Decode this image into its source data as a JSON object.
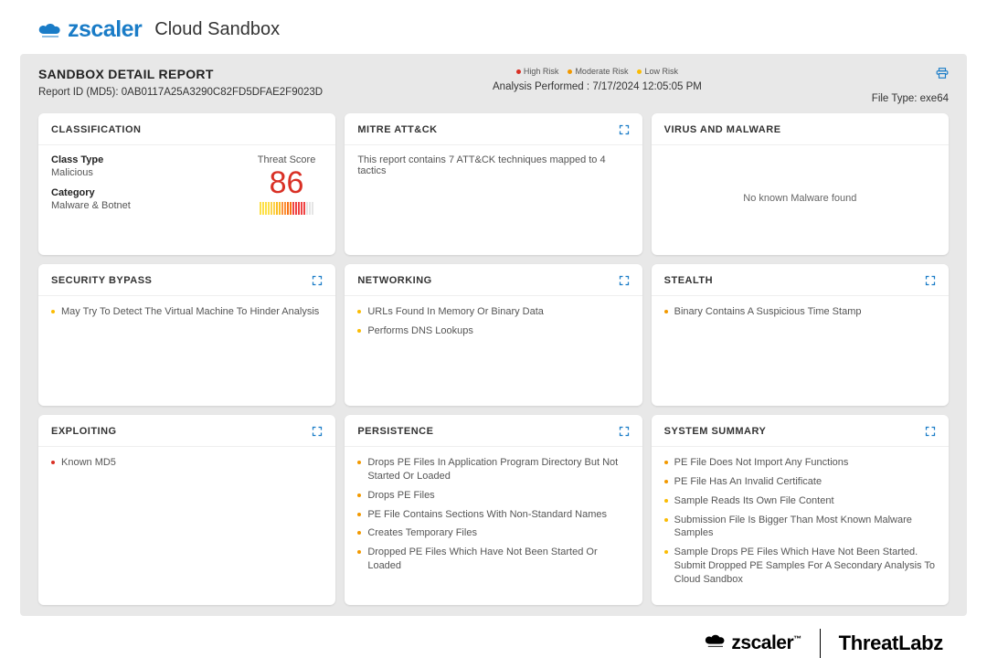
{
  "header": {
    "brand": "zscaler",
    "product": "Cloud Sandbox"
  },
  "report": {
    "title": "SANDBOX DETAIL REPORT",
    "id_label": "Report ID (MD5):",
    "id_value": "0AB0117A25A3290C82FD5DFAE2F9023D",
    "analysis_label": "Analysis Performed :",
    "analysis_time": "7/17/2024 12:05:05 PM",
    "file_type_label": "File Type:",
    "file_type_value": "exe64",
    "legend": {
      "high": "High Risk",
      "moderate": "Moderate Risk",
      "low": "Low Risk"
    }
  },
  "cards": {
    "classification": {
      "title": "CLASSIFICATION",
      "class_type_label": "Class Type",
      "class_type_value": "Malicious",
      "category_label": "Category",
      "category_value": "Malware & Botnet",
      "threat_score_label": "Threat Score",
      "threat_score": "86"
    },
    "mitre": {
      "title": "MITRE ATT&CK",
      "summary": "This report contains 7 ATT&CK techniques mapped to 4 tactics"
    },
    "virus": {
      "title": "VIRUS AND MALWARE",
      "message": "No known Malware found"
    },
    "security_bypass": {
      "title": "SECURITY BYPASS",
      "items": [
        {
          "risk": "yellow",
          "text": "May Try To Detect The Virtual Machine To Hinder Analysis"
        }
      ]
    },
    "networking": {
      "title": "NETWORKING",
      "items": [
        {
          "risk": "yellow",
          "text": "URLs Found In Memory Or Binary Data"
        },
        {
          "risk": "yellow",
          "text": "Performs DNS Lookups"
        }
      ]
    },
    "stealth": {
      "title": "STEALTH",
      "items": [
        {
          "risk": "orange",
          "text": "Binary Contains A Suspicious Time Stamp"
        }
      ]
    },
    "exploiting": {
      "title": "EXPLOITING",
      "items": [
        {
          "risk": "red",
          "text": "Known MD5"
        }
      ]
    },
    "persistence": {
      "title": "PERSISTENCE",
      "items": [
        {
          "risk": "orange",
          "text": "Drops PE Files In Application Program Directory But Not Started Or Loaded"
        },
        {
          "risk": "orange",
          "text": "Drops PE Files"
        },
        {
          "risk": "orange",
          "text": "PE File Contains Sections With Non-Standard Names"
        },
        {
          "risk": "orange",
          "text": "Creates Temporary Files"
        },
        {
          "risk": "orange",
          "text": "Dropped PE Files Which Have Not Been Started Or Loaded"
        }
      ]
    },
    "system_summary": {
      "title": "SYSTEM SUMMARY",
      "items": [
        {
          "risk": "orange",
          "text": "PE File Does Not Import Any Functions"
        },
        {
          "risk": "orange",
          "text": "PE File Has An Invalid Certificate"
        },
        {
          "risk": "yellow",
          "text": "Sample Reads Its Own File Content"
        },
        {
          "risk": "yellow",
          "text": "Submission File Is Bigger Than Most Known Malware Samples"
        },
        {
          "risk": "yellow",
          "text": "Sample Drops PE Files Which Have Not Been Started. Submit Dropped PE Samples For A Secondary Analysis To Cloud Sandbox"
        }
      ]
    }
  },
  "footer": {
    "brand": "zscaler",
    "tm": "™",
    "lab": "ThreatLabz"
  }
}
